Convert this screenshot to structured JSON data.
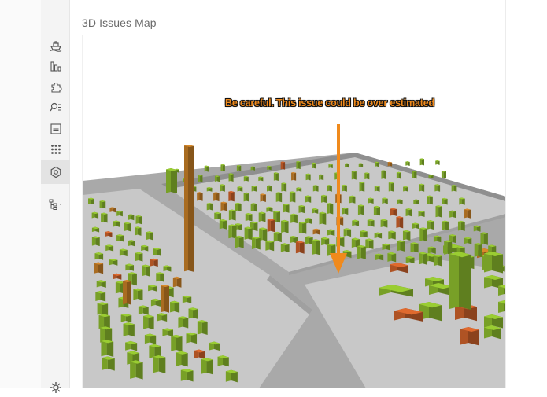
{
  "page": {
    "title": "3D Issues Map"
  },
  "annotation": {
    "text": "Be careful. This issue could be over estimated",
    "color": "#f08a1c"
  },
  "sidebar": {
    "items": [
      {
        "icon": "ship-icon"
      },
      {
        "icon": "bar-chart-icon"
      },
      {
        "icon": "puzzle-icon"
      },
      {
        "icon": "search-list-icon"
      },
      {
        "icon": "document-list-icon"
      },
      {
        "icon": "grid-dots-icon"
      },
      {
        "icon": "hexagon-nut-icon",
        "active": true
      },
      {
        "icon": "tree-dropdown-icon"
      },
      {
        "icon": "gear-icon"
      }
    ]
  },
  "colors": {
    "ground": "#c8c8c8",
    "road": "#a9a9a9",
    "good": "#9acd32",
    "warning": "#d98a2a",
    "bad": "#e06a2e",
    "critical": "#c83a2a"
  }
}
